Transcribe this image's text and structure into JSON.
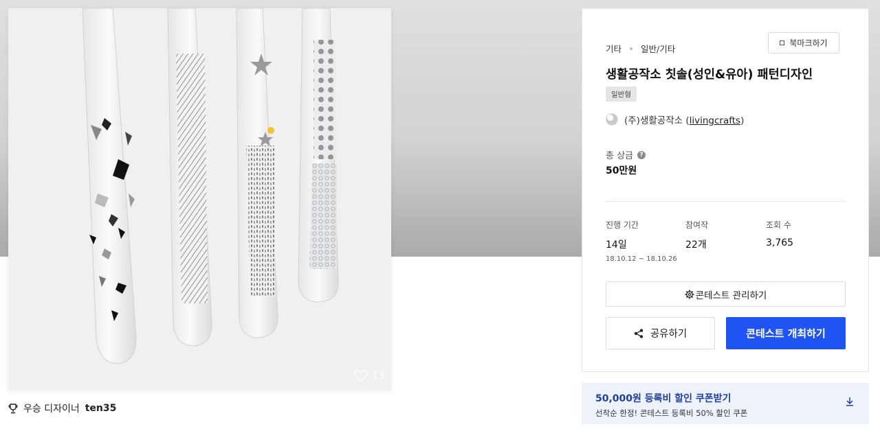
{
  "image": {
    "like_count": "13",
    "colors": {
      "bg": "#f0f0f0",
      "accent": "#f2c230"
    }
  },
  "winner": {
    "label": "우승 디자이너",
    "name": "ten35"
  },
  "panel": {
    "category_1": "기타",
    "category_2": "일반/기타",
    "bookmark_label": "북마크하기",
    "title": "생활공작소 칫솔(성인&유아) 패턴디자인",
    "type_badge": "일반형",
    "host_prefix": "(주)생활공작소 (",
    "host_handle": "livingcrafts",
    "host_suffix": ")",
    "prize_label": "총 상금",
    "prize_value": "50만원",
    "stats": {
      "period_label": "진행 기간",
      "period_value": "14일",
      "period_range": "18.10.12 ~ 18.10.26",
      "entries_label": "참여작",
      "entries_value": "22개",
      "views_label": "조회 수",
      "views_value": "3,765"
    },
    "manage_label": "콘테스트 관리하기",
    "share_label": "공유하기",
    "host_contest_label": "콘테스트 개최하기",
    "accent_color": "#1f54f2"
  },
  "coupon": {
    "title": "50,000원 등록비 할인 쿠폰받기",
    "subtitle": "선착순 한정! 콘테스트 등록비 50% 할인 쿠폰"
  }
}
